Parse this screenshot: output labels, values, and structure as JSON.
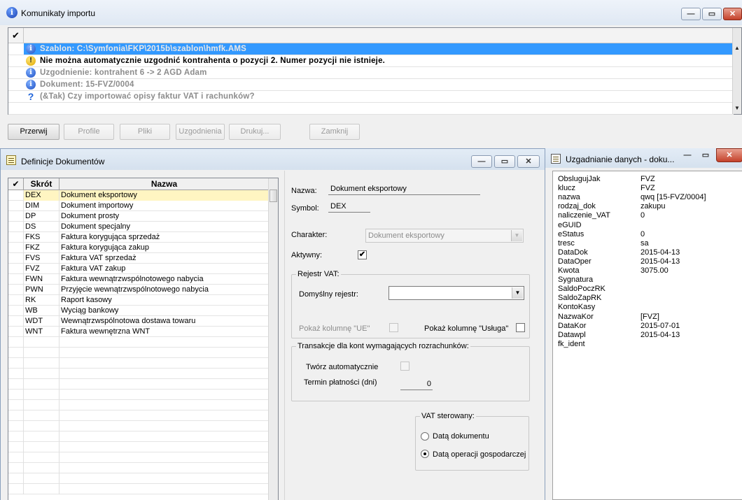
{
  "import_window": {
    "title": "Komunikaty importu",
    "messages": [
      {
        "icon": "info",
        "text": "Szablon: C:\\Symfonia\\FKP\\2015b\\szablon\\hmfk.AMS",
        "style": "selected"
      },
      {
        "icon": "warning",
        "text": "Nie można automatycznie uzgodnić kontrahenta o pozycji 2. Numer pozycji nie istnieje.",
        "style": "bold"
      },
      {
        "icon": "info",
        "text": "Uzgodnienie: kontrahent  6 -> 2 AGD Adam",
        "style": "grey"
      },
      {
        "icon": "info",
        "text": "Dokument: 15-FVZ/0004",
        "style": "grey"
      },
      {
        "icon": "question",
        "text": "(&Tak) Czy importować opisy faktur VAT i rachunków?",
        "style": "grey"
      }
    ],
    "buttons": {
      "przerwij": "Przerwij",
      "profile": "Profile",
      "pliki": "Pliki",
      "uzgodnienia": "Uzgodnienia",
      "drukuj": "Drukuj...",
      "zamknij": "Zamknij"
    }
  },
  "definitions_window": {
    "title": "Definicje Dokumentów",
    "columns": {
      "check": "✔",
      "skrot": "Skrót",
      "nazwa": "Nazwa"
    },
    "rows": [
      {
        "skrot": "DEX",
        "nazwa": "Dokument eksportowy"
      },
      {
        "skrot": "DIM",
        "nazwa": "Dokument importowy"
      },
      {
        "skrot": "DP",
        "nazwa": "Dokument prosty"
      },
      {
        "skrot": "DS",
        "nazwa": "Dokument specjalny"
      },
      {
        "skrot": "FKS",
        "nazwa": "Faktura korygująca sprzedaż"
      },
      {
        "skrot": "FKZ",
        "nazwa": "Faktura korygująca zakup"
      },
      {
        "skrot": "FVS",
        "nazwa": "Faktura VAT sprzedaż"
      },
      {
        "skrot": "FVZ",
        "nazwa": "Faktura VAT zakup"
      },
      {
        "skrot": "FWN",
        "nazwa": "Faktura wewnątrzwspólnotowego nabycia"
      },
      {
        "skrot": "PWN",
        "nazwa": "Przyjęcie wewnątrzwspólnotowego nabycia"
      },
      {
        "skrot": "RK",
        "nazwa": "Raport kasowy"
      },
      {
        "skrot": "WB",
        "nazwa": "Wyciąg bankowy"
      },
      {
        "skrot": "WDT",
        "nazwa": "Wewnątrzwspólnotowa dostawa towaru"
      },
      {
        "skrot": "WNT",
        "nazwa": "Faktura wewnętrzna WNT"
      }
    ],
    "empty_rows": 15,
    "form": {
      "nazwa_label": "Nazwa:",
      "nazwa_value": "Dokument eksportowy",
      "symbol_label": "Symbol:",
      "symbol_value": "DEX",
      "charakter_label": "Charakter:",
      "charakter_value": "Dokument eksportowy",
      "aktywny_label": "Aktywny:",
      "aktywny_checked": "✔",
      "rejestr_group": "Rejestr VAT:",
      "domyslny_label": "Domyślny rejestr:",
      "domyslny_value": "",
      "pokaz_ue_label": "Pokaż kolumnę \"UE\"",
      "pokaz_usluga_label": "Pokaż kolumnę \"Usługa\"",
      "transakcje_group": "Transakcje dla kont wymagających rozrachunków:",
      "tworz_label": "Twórz automatycznie",
      "termin_label": "Termin płatności (dni)",
      "termin_value": "0",
      "vat_group": "VAT sterowany:",
      "radio_dokumentu": "Datą dokumentu",
      "radio_operacji": "Datą operacji gospodarczej",
      "selected_radio": "operacji"
    }
  },
  "data_window": {
    "title": "Uzgadnianie danych - doku...",
    "fields": [
      {
        "key": "ObslugujJak",
        "value": "FVZ"
      },
      {
        "key": "klucz",
        "value": "FVZ"
      },
      {
        "key": "nazwa",
        "value": "qwq [15-FVZ/0004]"
      },
      {
        "key": "rodzaj_dok",
        "value": "zakupu"
      },
      {
        "key": "naliczenie_VAT",
        "value": "0"
      },
      {
        "key": "eGUID",
        "value": ""
      },
      {
        "key": "eStatus",
        "value": "0"
      },
      {
        "key": "tresc",
        "value": "sa"
      },
      {
        "key": "DataDok",
        "value": "2015-04-13"
      },
      {
        "key": "DataOper",
        "value": "2015-04-13"
      },
      {
        "key": "Kwota",
        "value": "3075.00"
      },
      {
        "key": "Sygnatura",
        "value": ""
      },
      {
        "key": "SaldoPoczRK",
        "value": ""
      },
      {
        "key": "SaldoZapRK",
        "value": ""
      },
      {
        "key": "KontoKasy",
        "value": ""
      },
      {
        "key": "NazwaKor",
        "value": "[FVZ]"
      },
      {
        "key": "DataKor",
        "value": "2015-07-01"
      },
      {
        "key": "Datawpl",
        "value": "2015-04-13"
      },
      {
        "key": "fk_ident",
        "value": ""
      }
    ]
  },
  "window_controls": {
    "minimize": "—",
    "maximize": "▭",
    "close": "✕"
  }
}
